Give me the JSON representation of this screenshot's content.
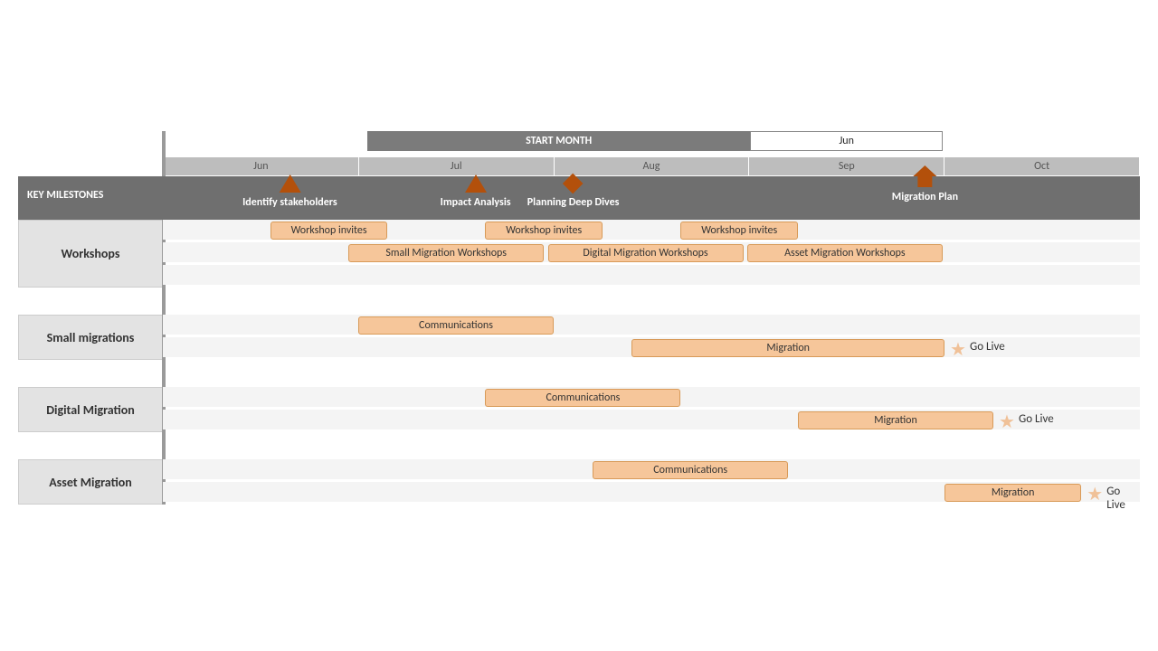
{
  "chart_data": {
    "type": "gantt",
    "title": "",
    "start_month_label": "START MONTH",
    "start_month_value": "Jun",
    "months": [
      "Jun",
      "Jul",
      "Aug",
      "Sep",
      "Oct"
    ],
    "key_milestones_label": "KEY MILESTONES",
    "milestones": [
      {
        "label": "Identify stakeholders",
        "month": "Jun",
        "pos": 0.65,
        "shape": "triangle"
      },
      {
        "label": "Impact Analysis",
        "month": "Jul",
        "pos": 1.6,
        "shape": "triangle"
      },
      {
        "label": "Planning Deep Dives",
        "month": "Aug",
        "pos": 2.1,
        "shape": "diamond"
      },
      {
        "label": "Migration Plan",
        "month": "Sep",
        "pos": 3.9,
        "shape": "arrow"
      }
    ],
    "sections": [
      {
        "name": "Workshops",
        "rows": [
          [
            {
              "label": "Workshop invites",
              "start": 0.55,
              "span": 0.6
            },
            {
              "label": "Workshop invites",
              "start": 1.65,
              "span": 0.6
            },
            {
              "label": "Workshop invites",
              "start": 2.65,
              "span": 0.6
            }
          ],
          [
            {
              "label": "Small Migration Workshops",
              "start": 0.95,
              "span": 1.0
            },
            {
              "label": "Digital Migration Workshops",
              "start": 1.97,
              "span": 1.0
            },
            {
              "label": "Asset Migration Workshops",
              "start": 2.99,
              "span": 1.0
            }
          ],
          []
        ]
      },
      {
        "name": "Small migrations",
        "rows": [
          [
            {
              "label": "Communications",
              "start": 1.0,
              "span": 1.0
            }
          ],
          [
            {
              "label": "Migration",
              "start": 2.4,
              "span": 1.6,
              "golive": true,
              "golive_label": "Go Live"
            }
          ]
        ]
      },
      {
        "name": "Digital Migration",
        "rows": [
          [
            {
              "label": "Communications",
              "start": 1.65,
              "span": 1.0
            }
          ],
          [
            {
              "label": "Migration",
              "start": 3.25,
              "span": 1.0,
              "golive": true,
              "golive_label": "Go Live"
            }
          ]
        ]
      },
      {
        "name": "Asset Migration",
        "rows": [
          [
            {
              "label": "Communications",
              "start": 2.2,
              "span": 1.0
            }
          ],
          [
            {
              "label": "Migration",
              "start": 4.0,
              "span": 0.7,
              "golive": true,
              "golive_label": "Go Live"
            }
          ]
        ]
      }
    ]
  }
}
